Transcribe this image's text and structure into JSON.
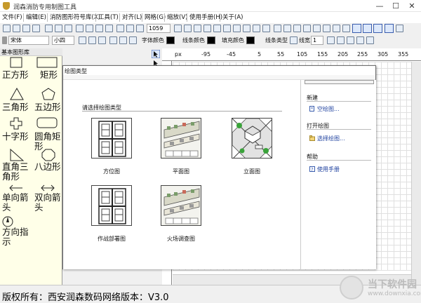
{
  "window": {
    "title": "润森消防专用制图工具",
    "minimize": "—",
    "maximize": "☐",
    "close": "✕"
  },
  "menu": [
    {
      "label": "文件(F)"
    },
    {
      "label": "编辑(E)"
    },
    {
      "label": "消防图形符号库(X)"
    },
    {
      "label": "工具(T)"
    },
    {
      "label": "对齐(L)"
    },
    {
      "label": "网格(G)"
    },
    {
      "label": "缩放(V)"
    },
    {
      "label": "使用手册(H)"
    },
    {
      "label": "关于(A)"
    }
  ],
  "toolbar1": {
    "zoom_value": "1059"
  },
  "toolbar2": {
    "font_family": "宋体",
    "font_size": "小四",
    "font_color_label": "字体颜色",
    "line_color_label": "线条颜色",
    "fill_color_label": "填充颜色",
    "line_type_label": "线条类型",
    "line_width_label": "线宽",
    "line_width_value": "1",
    "colors": {
      "font": "#000000",
      "line": "#000000",
      "fill": "#000000"
    }
  },
  "library": {
    "title": "基本图形库",
    "shapes": [
      {
        "label": "正方形",
        "icon": "square-icon"
      },
      {
        "label": "矩形",
        "icon": "rectangle-icon"
      },
      {
        "label": "三角形",
        "icon": "triangle-icon"
      },
      {
        "label": "五边形",
        "icon": "pentagon-icon"
      },
      {
        "label": "十字形",
        "icon": "cross-icon"
      },
      {
        "label": "圆角矩形",
        "icon": "rounded-rectangle-icon"
      },
      {
        "label": "直角三角形",
        "icon": "right-triangle-icon"
      },
      {
        "label": "八边形",
        "icon": "octagon-icon"
      },
      {
        "label": "单向箭头",
        "icon": "single-arrow-icon"
      },
      {
        "label": "双向箭头",
        "icon": "double-arrow-icon"
      },
      {
        "label": "方向指示",
        "icon": "direction-indicator-icon"
      }
    ]
  },
  "ruler": {
    "unit": "px",
    "ticks": [
      "-95",
      "-45",
      "5",
      "55",
      "105",
      "155",
      "205",
      "255",
      "305",
      "355"
    ]
  },
  "dialog": {
    "title": "绘图类型",
    "section_title": "请选择绘图类型",
    "types": [
      {
        "label": "方位图",
        "icon": "location-map-icon"
      },
      {
        "label": "平面图",
        "icon": "floor-plan-icon"
      },
      {
        "label": "立面图",
        "icon": "elevation-icon"
      },
      {
        "label": "作战部署图",
        "icon": "deployment-map-icon"
      },
      {
        "label": "火场调查图",
        "icon": "fire-survey-map-icon"
      }
    ],
    "side": {
      "new_title": "新建",
      "new_blank": "空绘图...",
      "open_title": "打开绘图",
      "open_select": "选择绘图...",
      "help_title": "帮助",
      "help_manual": "使用手册"
    }
  },
  "status": {
    "text": "版权所有：西安润森数码网络版本：V3.0"
  },
  "watermark": {
    "name": "当下软件园",
    "url": "www.downxia.com"
  }
}
